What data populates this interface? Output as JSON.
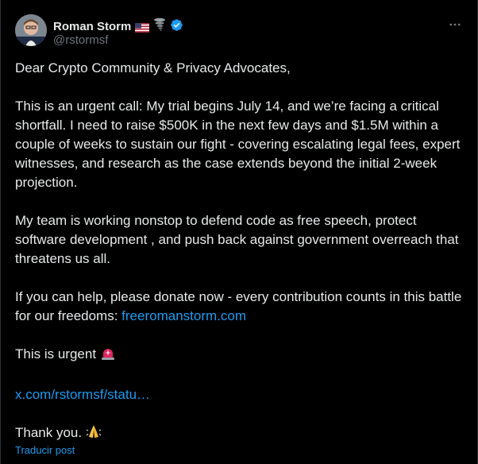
{
  "author": {
    "display_name": "Roman Storm",
    "handle": "@rstormsf",
    "badges": [
      "us-flag-icon",
      "tornado-icon",
      "verified-badge-icon"
    ]
  },
  "post": {
    "p1": "Dear Crypto Community & Privacy Advocates,",
    "p2": "This is an urgent call: My trial begins July 14, and we’re facing a critical shortfall. I need to raise $500K in the next few days and $1.5M within a couple of weeks to sustain our fight - covering escalating legal fees, expert witnesses, and research as the case extends beyond the initial 2-week projection.",
    "p3": "My team is working nonstop to defend code as free speech, protect software development , and push back against government overreach that threatens us all.",
    "p4_text": "If you can help, please donate now - every contribution counts in this battle for our freedoms: ",
    "p4_link": "freeromanstorm.com",
    "p5": "This is urgent",
    "p6_link": "x.com/rstormsf/statu…",
    "p7": "Thank you."
  },
  "translate_label": "Traducir post",
  "colors": {
    "link": "#1d9bf0",
    "text": "#e7e9ea",
    "muted": "#71767b",
    "background": "#000000"
  }
}
